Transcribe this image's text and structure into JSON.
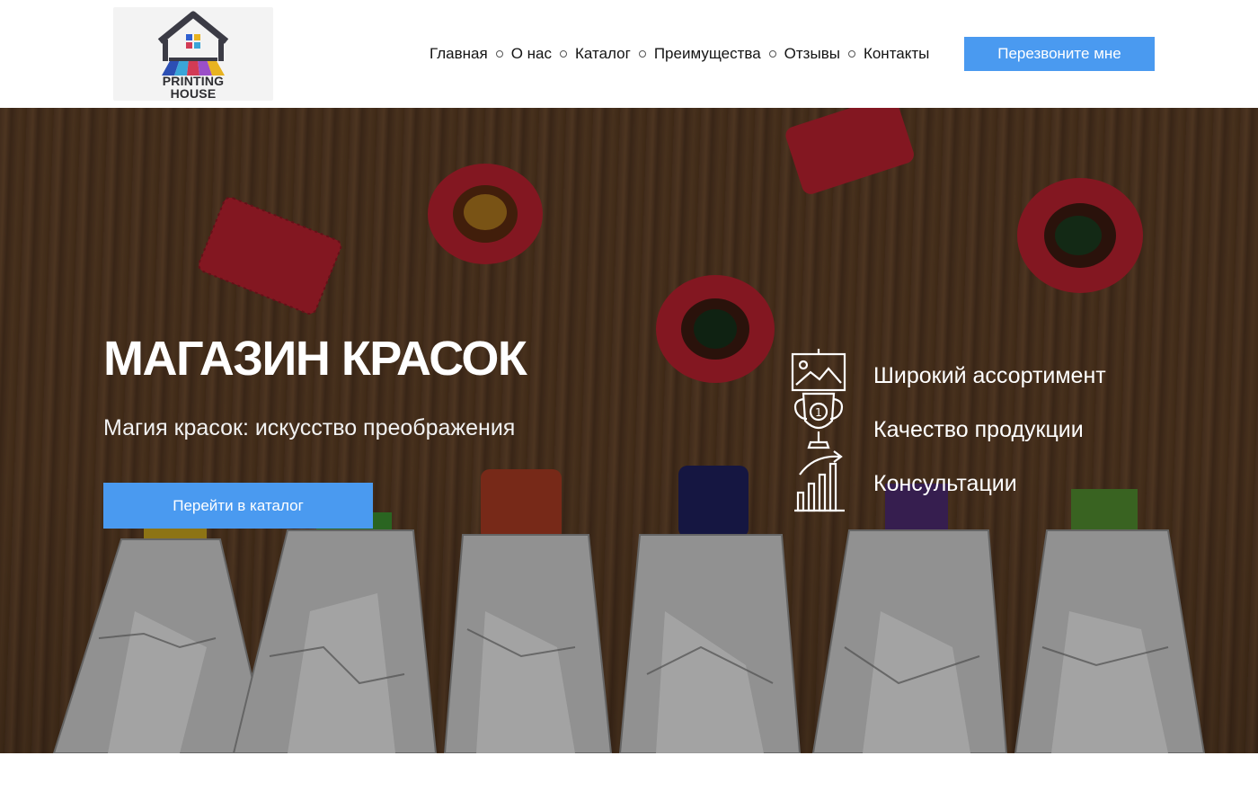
{
  "header": {
    "logo": {
      "line1": "PRINTING",
      "line2": "HOUSE"
    },
    "nav": [
      "Главная",
      "О нас",
      "Каталог",
      "Преимущества",
      "Отзывы",
      "Контакты"
    ],
    "callback_label": "Перезвоните мне"
  },
  "hero": {
    "title": "МАГАЗИН КРАСОК",
    "subtitle": "Магия красок: искусство преображения",
    "catalog_button": "Перейти в каталог",
    "features": [
      {
        "icon": "image-icon",
        "label": "Широкий ассортимент"
      },
      {
        "icon": "trophy-icon",
        "label": "Качество продукции"
      },
      {
        "icon": "growth-chart-icon",
        "label": "Консультации"
      }
    ]
  },
  "colors": {
    "accent": "#4a9af0",
    "cap_red": "#c62a3a",
    "wood": "#5c3f28"
  }
}
